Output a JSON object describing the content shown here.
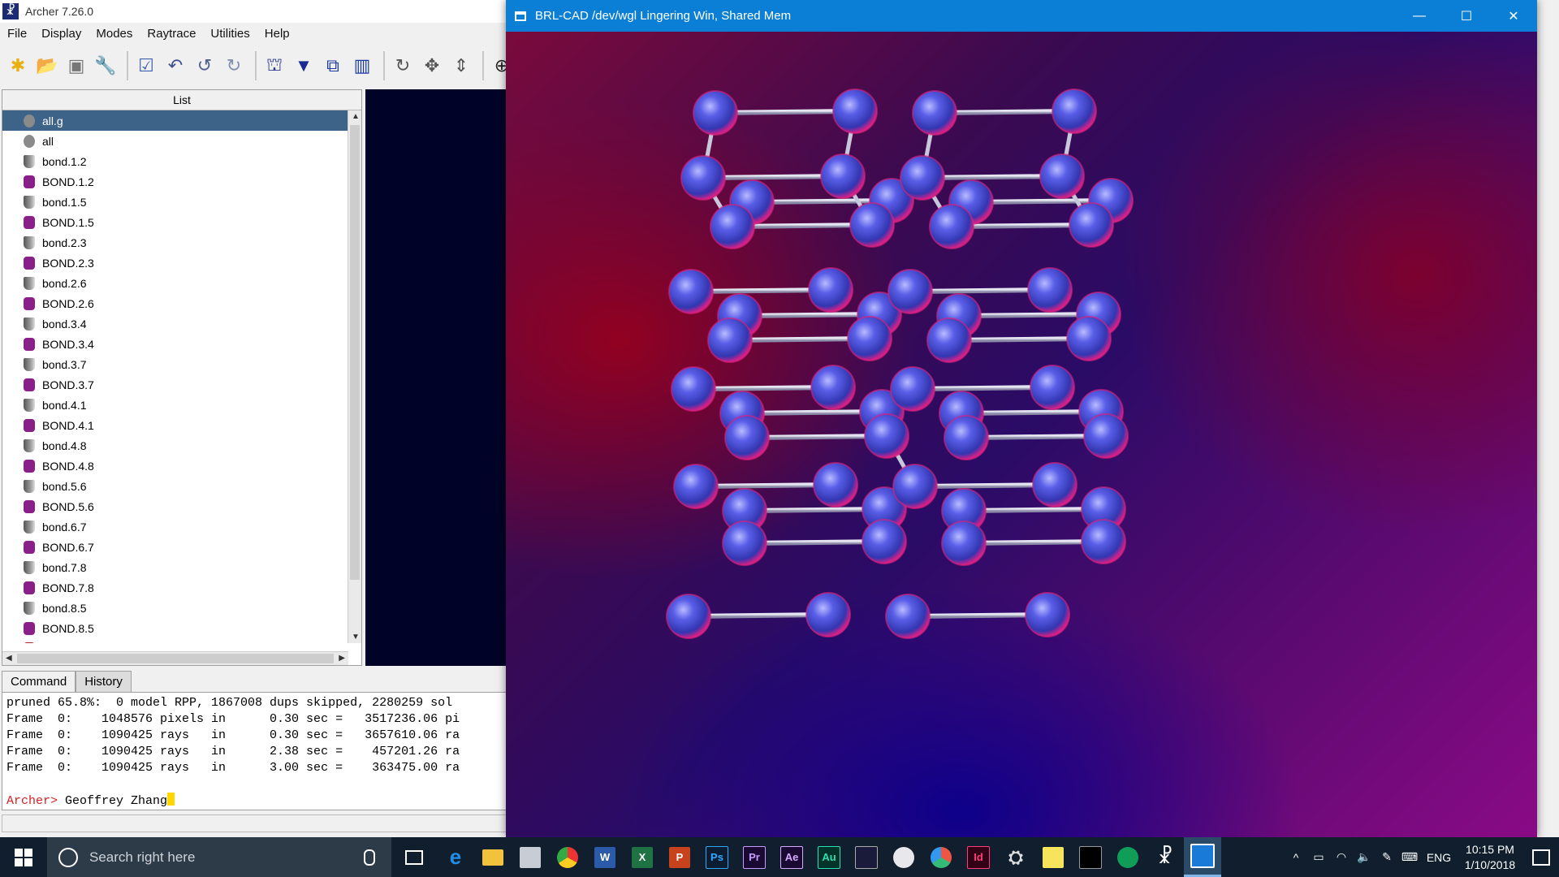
{
  "archer": {
    "title": "Archer 7.26.0",
    "menu": [
      "File",
      "Display",
      "Modes",
      "Raytrace",
      "Utilities",
      "Help"
    ],
    "list_header": "List",
    "tree": [
      {
        "label": "all.g",
        "type": "db",
        "selected": true
      },
      {
        "label": "all",
        "type": "comb"
      },
      {
        "label": "bond.1.2",
        "type": "prim"
      },
      {
        "label": "BOND.1.2",
        "type": "reg"
      },
      {
        "label": "bond.1.5",
        "type": "prim"
      },
      {
        "label": "BOND.1.5",
        "type": "reg"
      },
      {
        "label": "bond.2.3",
        "type": "prim"
      },
      {
        "label": "BOND.2.3",
        "type": "reg"
      },
      {
        "label": "bond.2.6",
        "type": "prim"
      },
      {
        "label": "BOND.2.6",
        "type": "reg"
      },
      {
        "label": "bond.3.4",
        "type": "prim"
      },
      {
        "label": "BOND.3.4",
        "type": "reg"
      },
      {
        "label": "bond.3.7",
        "type": "prim"
      },
      {
        "label": "BOND.3.7",
        "type": "reg"
      },
      {
        "label": "bond.4.1",
        "type": "prim"
      },
      {
        "label": "BOND.4.1",
        "type": "reg"
      },
      {
        "label": "bond.4.8",
        "type": "prim"
      },
      {
        "label": "BOND.4.8",
        "type": "reg"
      },
      {
        "label": "bond.5.6",
        "type": "prim"
      },
      {
        "label": "BOND.5.6",
        "type": "reg"
      },
      {
        "label": "bond.6.7",
        "type": "prim"
      },
      {
        "label": "BOND.6.7",
        "type": "reg"
      },
      {
        "label": "bond.7.8",
        "type": "prim"
      },
      {
        "label": "BOND.7.8",
        "type": "reg"
      },
      {
        "label": "bond.8.5",
        "type": "prim"
      },
      {
        "label": "BOND.8.5",
        "type": "reg"
      },
      {
        "label": "cloud.r.bak",
        "type": "bak"
      }
    ],
    "tabs": [
      "Command",
      "History"
    ],
    "console_lines": [
      "pruned 65.8%:  0 model RPP, 1867008 dups skipped, 2280259 sol",
      "Frame  0:    1048576 pixels in      0.30 sec =   3517236.06 pi",
      "Frame  0:    1090425 rays   in      0.30 sec =   3657610.06 ra",
      "Frame  0:    1090425 rays   in      2.38 sec =    457201.26 ra",
      "Frame  0:    1090425 rays   in      3.00 sec =    363475.00 ra"
    ],
    "prompt": "Archer>",
    "input": " Geoffrey Zhang"
  },
  "brl": {
    "title": "BRL-CAD /dev/wgl Lingering Win, Shared Mem",
    "sphere_color": "#4a4ee0",
    "rim_color": "#e0207a"
  },
  "taskbar": {
    "search_placeholder": "Search right here",
    "apps": [
      "edge-icon",
      "file-explorer-icon",
      "mail-icon",
      "chrome-icon",
      "word-icon",
      "excel-icon",
      "powerpoint-icon",
      "photoshop-icon",
      "premiere-icon",
      "after-effects-icon",
      "audition-icon",
      "animate-icon",
      "paint-icon",
      "davinci-icon",
      "indesign-icon",
      "satellite-icon",
      "sticky-notes-icon",
      "terminal-icon",
      "hangouts-icon",
      "archer-icon",
      "brlcad-icon"
    ],
    "app_labels": {
      "word": "W",
      "excel": "X",
      "powerpoint": "P",
      "photoshop": "Ps",
      "premiere": "Pr",
      "after_effects": "Ae",
      "audition": "Au",
      "indesign": "Id"
    },
    "lang": "ENG",
    "time": "10:15 PM",
    "date": "1/10/2018"
  }
}
